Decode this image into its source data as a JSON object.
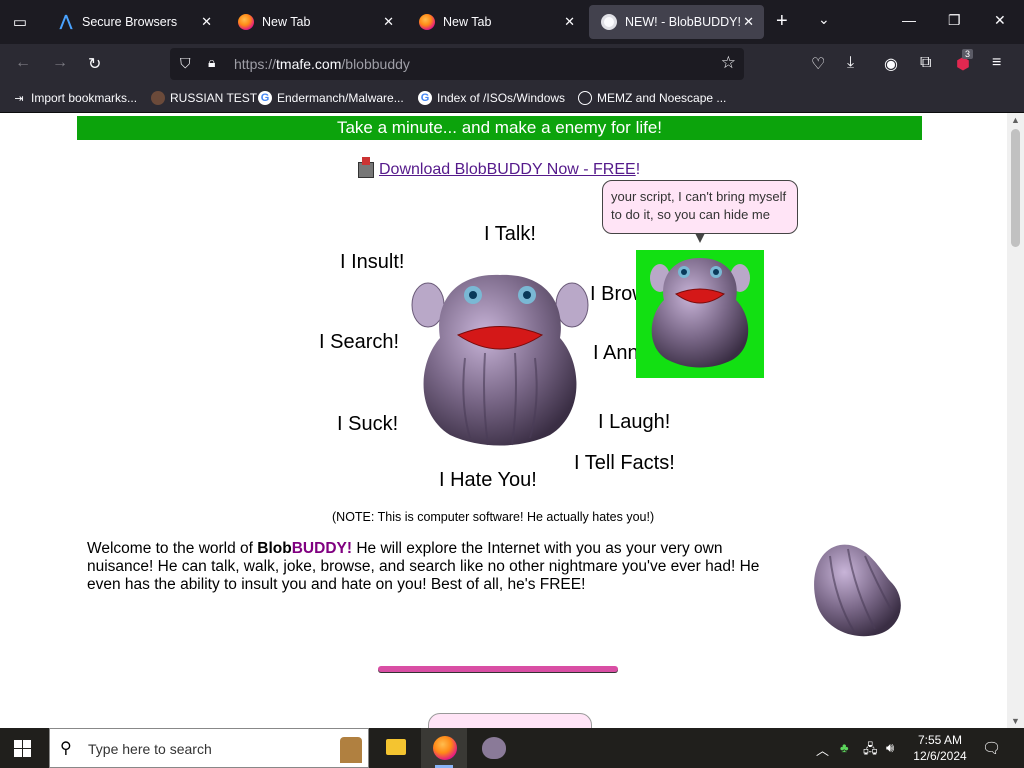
{
  "tabs": [
    {
      "title": "Secure Browsers",
      "icon": "secure-browsers-icon"
    },
    {
      "title": "New Tab",
      "icon": "firefox-icon"
    },
    {
      "title": "New Tab",
      "icon": "firefox-icon"
    },
    {
      "title": "NEW! - BlobBUDDY!",
      "icon": "blobbuddy-icon",
      "active": true
    }
  ],
  "url": {
    "prefix": "https://",
    "host": "tmafe.com",
    "path": "/blobbuddy"
  },
  "extension_badge": "3",
  "bookmarks": [
    {
      "label": "Import bookmarks...",
      "icon": "import-icon"
    },
    {
      "label": "RUSSIAN TEST",
      "icon": "russian-test-icon"
    },
    {
      "label": "Endermanch/Malware...",
      "icon": "google-icon"
    },
    {
      "label": "Index of /ISOs/Windows",
      "icon": "google-icon"
    },
    {
      "label": "MEMZ and Noescape ...",
      "icon": "globe-icon"
    }
  ],
  "page": {
    "banner": "Take a minute... and make a enemy for life!",
    "download_label": "Download BlobBUDDY Now - FREE",
    "download_excl": "!",
    "features": {
      "talk": "I Talk!",
      "insult": "I Insult!",
      "browse": "I Browse!",
      "search": "I Search!",
      "annoy": "I Annoy!",
      "suck": "I Suck!",
      "laugh": "I Laugh!",
      "facts": "I Tell Facts!",
      "hate": "I Hate You!"
    },
    "bubble_text": "your script, I can't bring myself to do it, so you can hide me",
    "note": "(NOTE: This is computer software! He actually hates you!)",
    "welcome": {
      "pre": "Welcome to the world of ",
      "blob": "Blob",
      "buddy": "BUDDY!",
      "post": " He will explore the Internet with you as your very own nuisance!  He can talk, walk, joke, browse, and search like no other nightmare you've ever had! He even has the ability to insult you and hate on you! Best of all, he's FREE!"
    }
  },
  "taskbar": {
    "search_placeholder": "Type here to search",
    "time": "7:55 AM",
    "date": "12/6/2024"
  },
  "colors": {
    "banner_green": "#0ca30c",
    "buddy_purple": "#800080",
    "link_purple": "#551a8b",
    "green_box": "#12e012",
    "bubble_pink": "#ffe4f6"
  }
}
